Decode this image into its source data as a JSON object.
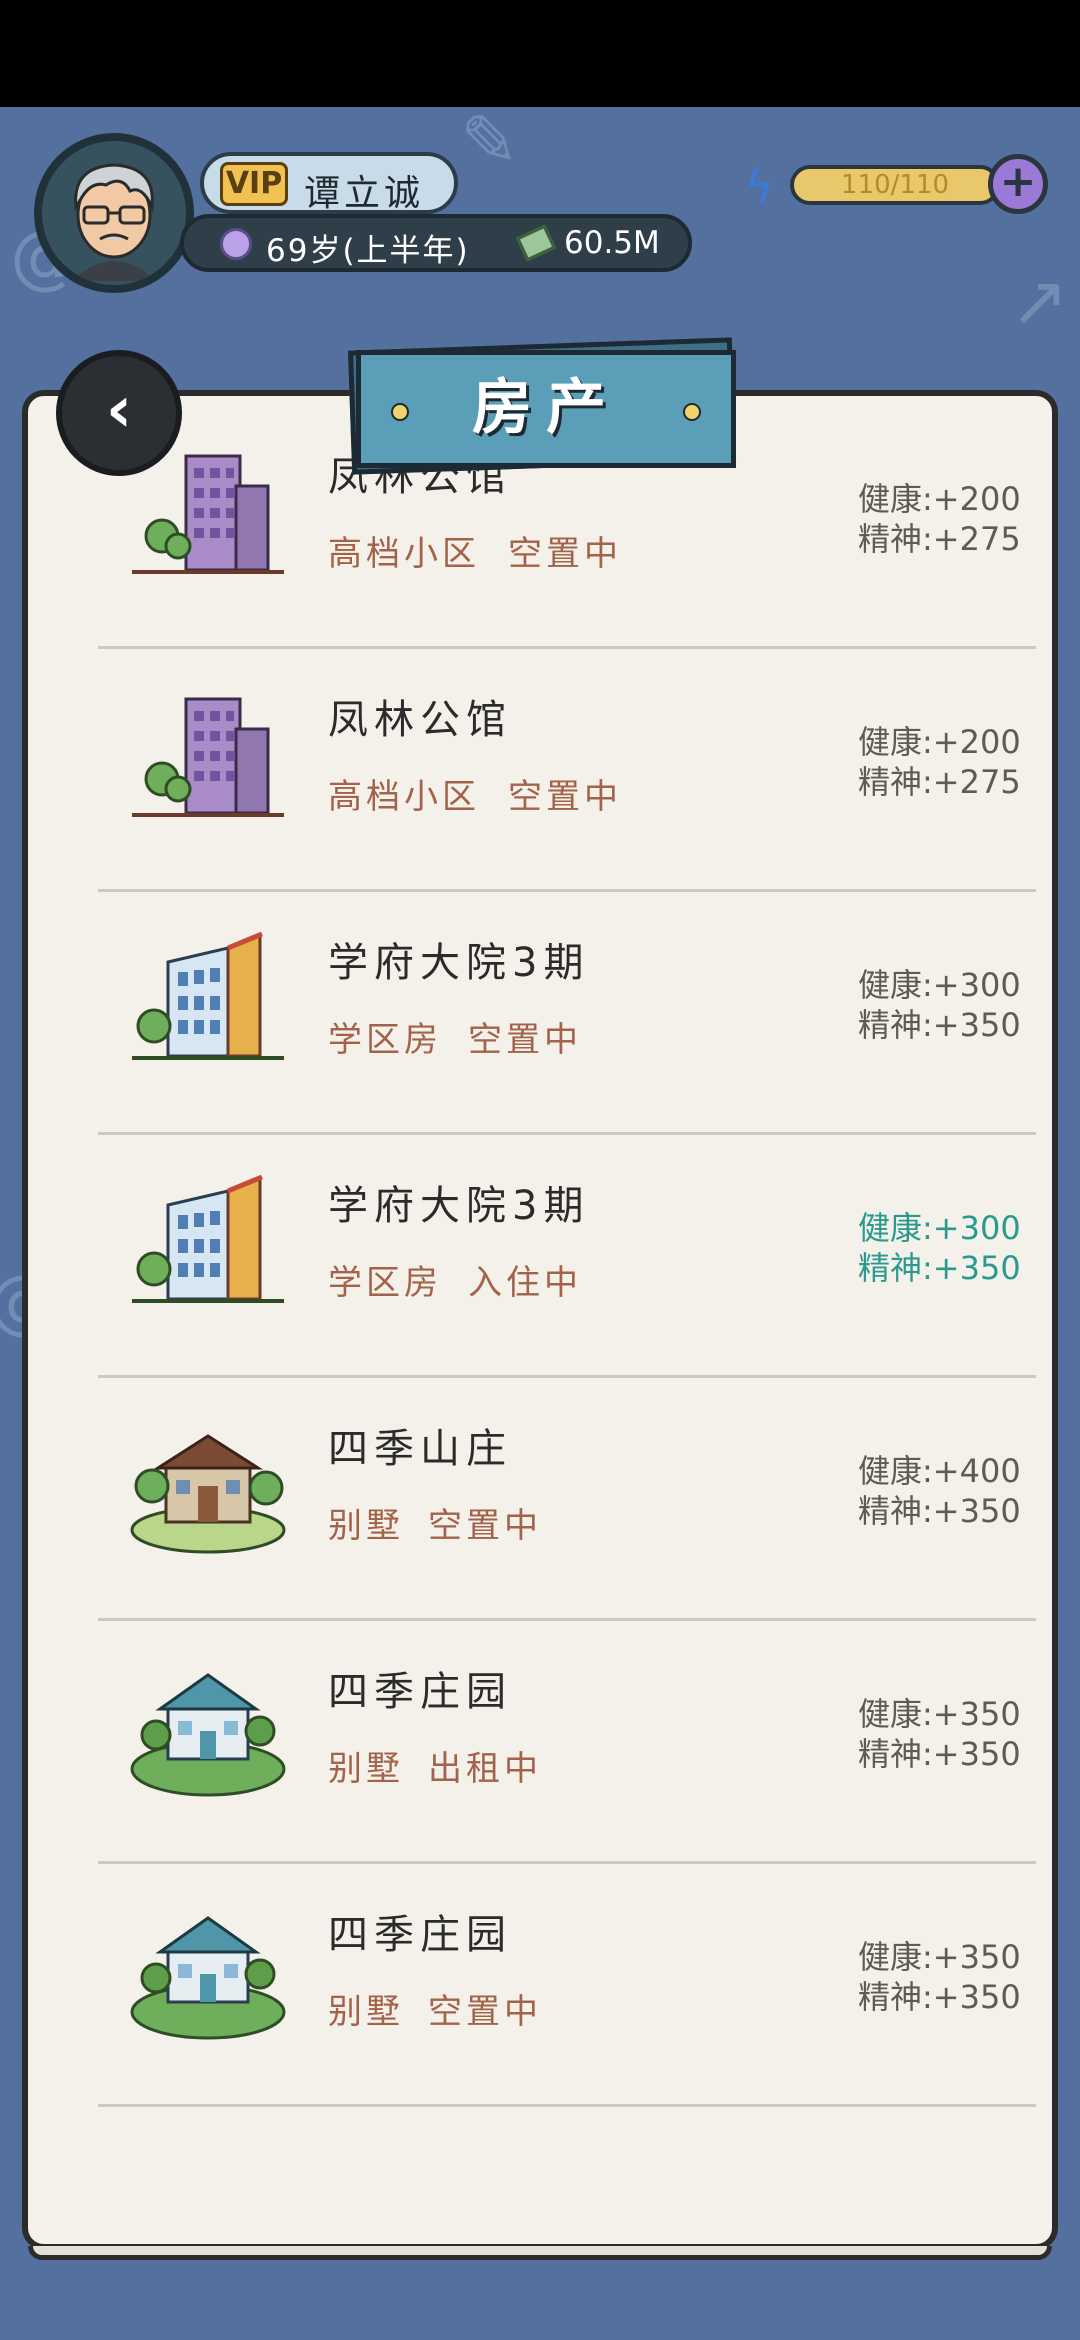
{
  "player": {
    "vip": "VIP",
    "name": "谭立诚",
    "age": "69岁(上半年)",
    "money": "60.5M",
    "energy": "110/110"
  },
  "panel": {
    "title": "房产"
  },
  "properties": [
    {
      "name": "凤林公馆",
      "type": "高档小区",
      "status": "空置中",
      "health": "健康:+200",
      "spirit": "精神:+275",
      "icon": "apartment-tower-icon"
    },
    {
      "name": "凤林公馆",
      "type": "高档小区",
      "status": "空置中",
      "health": "健康:+200",
      "spirit": "精神:+275",
      "icon": "apartment-tower-icon"
    },
    {
      "name": "学府大院3期",
      "type": "学区房",
      "status": "空置中",
      "health": "健康:+300",
      "spirit": "精神:+350",
      "icon": "school-district-building-icon"
    },
    {
      "name": "学府大院3期",
      "type": "学区房",
      "status": "入住中",
      "health": "健康:+300",
      "spirit": "精神:+350",
      "icon": "school-district-building-icon"
    },
    {
      "name": "四季山庄",
      "type": "别墅",
      "status": "空置中",
      "health": "健康:+400",
      "spirit": "精神:+350",
      "icon": "villa-icon"
    },
    {
      "name": "四季庄园",
      "type": "别墅",
      "status": "出租中",
      "health": "健康:+350",
      "spirit": "精神:+350",
      "icon": "manor-icon"
    },
    {
      "name": "四季庄园",
      "type": "别墅",
      "status": "空置中",
      "health": "健康:+350",
      "spirit": "精神:+350",
      "icon": "manor-icon"
    }
  ],
  "colors": {
    "background": "#53709f",
    "accent": "#5a9eb7",
    "status": "#a3624a",
    "active": "#2a9a8f"
  }
}
